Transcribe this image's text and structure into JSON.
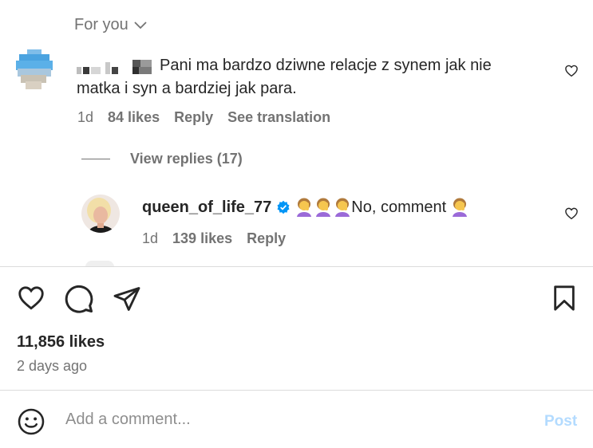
{
  "comments_header": {
    "sort_label": "For you"
  },
  "comment_1": {
    "text": "Pani ma bardzo dziwne relacje z synem jak nie matka i syn a bardziej jak para.",
    "time": "1d",
    "likes": "84 likes",
    "reply_label": "Reply",
    "translate_label": "See translation"
  },
  "view_replies": "View replies (17)",
  "reply_1": {
    "username": "queen_of_life_77",
    "text": "No, comment",
    "time": "1d",
    "likes": "139 likes",
    "reply_label": "Reply"
  },
  "post_footer": {
    "likes": "11,856 likes",
    "posted": "2 days ago"
  },
  "comment_box": {
    "placeholder": "Add a comment...",
    "post_label": "Post"
  },
  "colors": {
    "text": "#262626",
    "secondary_text": "#737373",
    "verified_badge": "#0095f6",
    "post_disabled": "#b3dbff",
    "divider": "#dbdbdb"
  },
  "icons": [
    "chevron-down-icon",
    "heart-icon",
    "comment-icon",
    "share-icon",
    "bookmark-icon",
    "emoji-icon",
    "verified-icon"
  ]
}
